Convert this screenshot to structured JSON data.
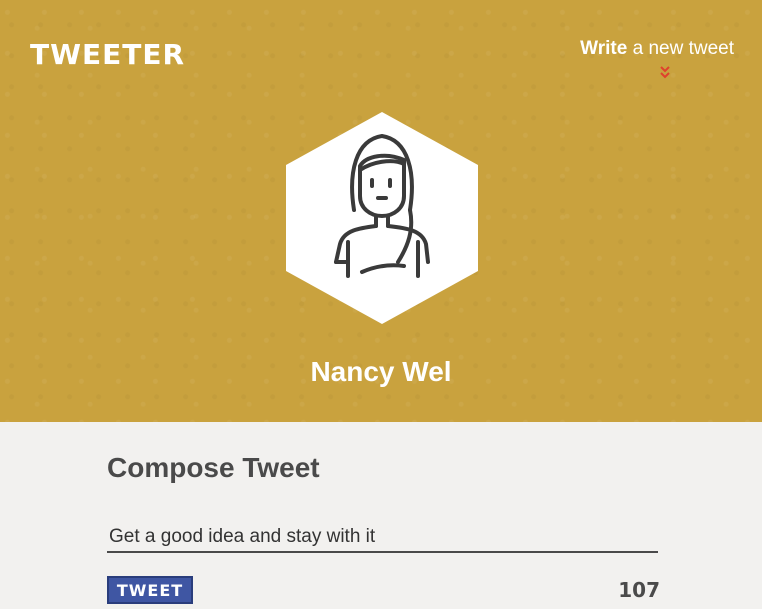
{
  "header": {
    "logo": "TWEETER",
    "write_link_strong": "Write",
    "write_link_rest": " a new tweet",
    "chevron_icon": "double-chevron-down-icon",
    "avatar_icon": "woman-avatar-icon",
    "user_name": "Nancy Wel"
  },
  "compose": {
    "title": "Compose Tweet",
    "input_value": "Get a good idea and stay with it",
    "tweet_button_label": "TWEET",
    "char_counter": "107"
  },
  "colors": {
    "header_bg": "#c9a23e",
    "body_bg": "#f2f1ef",
    "button_bg": "#3f56a3",
    "chevron": "#e0412d"
  }
}
